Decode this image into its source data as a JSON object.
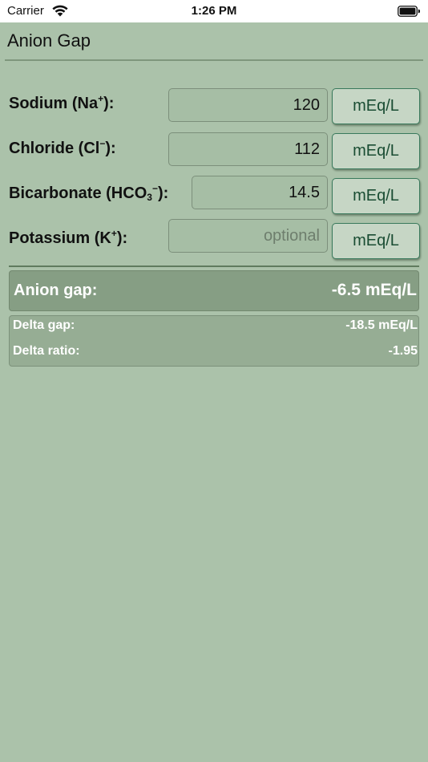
{
  "status_bar": {
    "carrier": "Carrier",
    "time": "1:26 PM",
    "wifi_icon": "wifi-icon",
    "battery_icon": "battery-icon"
  },
  "app": {
    "title": "Anion Gap"
  },
  "inputs": [
    {
      "label_base": "Sodium (Na",
      "label_sup": "+",
      "label_sub": "",
      "label_end": "):",
      "value": "120",
      "placeholder": "",
      "unit": "mEq/L"
    },
    {
      "label_base": "Chloride (Cl",
      "label_sup": "−",
      "label_sub": "",
      "label_end": "):",
      "value": "112",
      "placeholder": "",
      "unit": "mEq/L"
    },
    {
      "label_base": "Bicarbonate (HCO",
      "label_sup": "",
      "label_sub": "3",
      "label_end": "):",
      "label_sup_after": "−",
      "value": "14.5",
      "placeholder": "",
      "unit": "mEq/L"
    },
    {
      "label_base": "Potassium (K",
      "label_sup": "+",
      "label_sub": "",
      "label_end": "):",
      "value": "",
      "placeholder": "optional",
      "unit": "mEq/L"
    }
  ],
  "results": {
    "anion_gap_label": "Anion gap:",
    "anion_gap_value": "-6.5 mEq/L",
    "delta_gap_label": "Delta gap:",
    "delta_gap_value": "-18.5 mEq/L",
    "delta_ratio_label": "Delta ratio:",
    "delta_ratio_value": "-1.95"
  },
  "colors": {
    "background": "#abc2aa",
    "unit_text": "#1a4d33",
    "result_box": "#869e84",
    "delta_box": "#96ad94"
  }
}
